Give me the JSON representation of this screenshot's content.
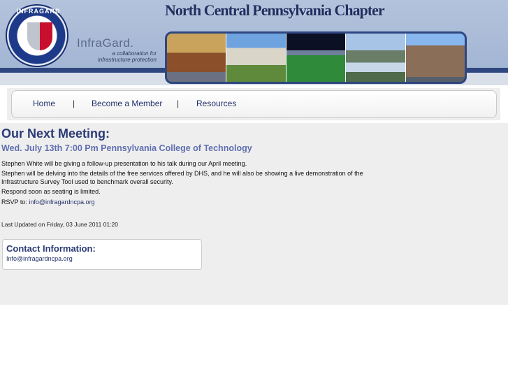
{
  "header": {
    "seal_text": "INFRAGARD",
    "brand_name": "InfraGard.",
    "brand_tagline_1": "a collaboration for",
    "brand_tagline_2": "infrastructure protection",
    "chapter_title": "North Central Pennsylvania Chapter"
  },
  "nav": {
    "items": [
      {
        "label": "Home"
      },
      {
        "label": "Become a Member"
      },
      {
        "label": "Resources"
      }
    ],
    "separator": "|"
  },
  "meeting": {
    "title": "Our Next Meeting:",
    "date_line": "Wed. July 13th 7:00 Pm Pennsylvania College of Technology",
    "line1": "Stephen White will be giving a follow-up presentation to his talk during our April meeting.",
    "line2": "Stephen will be delving into the details of the free services offered by DHS, and he will also be showing a live  demonstration of  the",
    "line3": "Infrastructure Survey Tool  used to benchmark overall  security.",
    "line4": "Respond soon as seating is limited.",
    "rsvp_label": "RSVP to:",
    "rsvp_email": "info@infragardncpa.org"
  },
  "updated": "Last Updated on Friday, 03 June 2011 01:20",
  "contact": {
    "title": "Contact Information:",
    "email": "Info@infragardncpa.org"
  }
}
